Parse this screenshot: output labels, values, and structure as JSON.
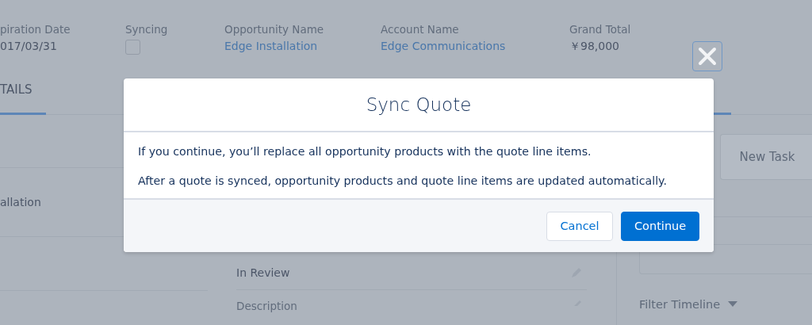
{
  "header": {
    "fields": [
      {
        "label": "piration Date",
        "kind": "text",
        "value": "017/03/31"
      },
      {
        "label": "Syncing",
        "kind": "checkbox",
        "checked": false
      },
      {
        "label": "Opportunity Name",
        "kind": "link",
        "value": "Edge Installation"
      },
      {
        "label": "Account Name",
        "kind": "link",
        "value": "Edge Communications"
      },
      {
        "label": "Grand Total",
        "kind": "text",
        "value": "￥98,000"
      }
    ]
  },
  "tabs": [
    {
      "label": "TAILS",
      "selected": true
    },
    {
      "selected": true
    }
  ],
  "details": {
    "left_value": "allation",
    "status_value": "In Review",
    "description_label": "Description"
  },
  "activity": {
    "new_task_button": "New Task",
    "filter": "Filter Timeline"
  },
  "modal": {
    "title": "Sync Quote",
    "paragraphs": [
      "If you continue, you’ll replace all opportunity products with the quote line items.",
      "After a quote is synced, opportunity products and quote line items are updated automatically."
    ],
    "buttons": [
      {
        "label": "Cancel",
        "kind": "neutral"
      },
      {
        "label": "Continue",
        "kind": "brand"
      }
    ]
  }
}
